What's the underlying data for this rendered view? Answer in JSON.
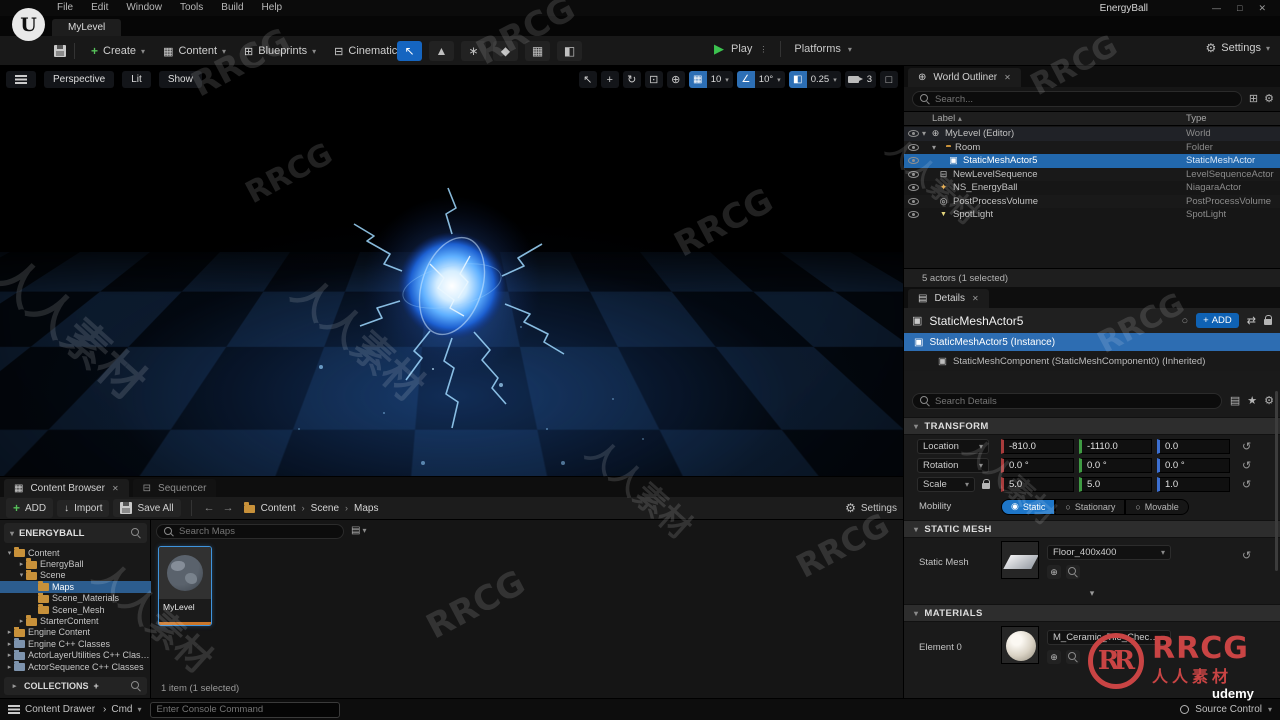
{
  "icons": {
    "caret_down": "▾",
    "caret_right": "▸",
    "caret_up": "▴",
    "chevron": "›",
    "gear": "⚙",
    "star": "★",
    "plus": "+",
    "play": "▶",
    "close": "✕",
    "minimize": "—",
    "maximize": "□",
    "dots": "⋮",
    "select": "↖",
    "move": "+",
    "rotate": "↻",
    "scale_tool": "⊡",
    "globe": "⊕",
    "grid": "▦",
    "angle": "∠",
    "scale_snap": "◧",
    "mesh": "▣",
    "sequence": "⊟",
    "particle": "✦",
    "postprocess": "◎",
    "spotlight": "▼",
    "back": "←",
    "forward": "→",
    "import_arrow": "↓",
    "swap": "⇄",
    "circle": "○",
    "undo": "↺",
    "radio_on": "◉",
    "radio_off": "○",
    "rows": "▤",
    "blueprint": "⊞",
    "cinematic": "⊟",
    "content": "▦"
  },
  "titlebar": {
    "logo": "U",
    "menus": [
      "File",
      "Edit",
      "Window",
      "Tools",
      "Build",
      "Help"
    ],
    "project": "EnergyBall"
  },
  "tabs": {
    "level_tab": "MyLevel"
  },
  "toolbar": {
    "create": "Create",
    "content": "Content",
    "blueprints": "Blueprints",
    "cinematics": "Cinematics",
    "play": "Play",
    "platforms": "Platforms",
    "settings": "Settings"
  },
  "viewport": {
    "perspective": "Perspective",
    "lit": "Lit",
    "show": "Show",
    "grid_value": "10",
    "angle_value": "10°",
    "scale_value": "0.25",
    "camera_value": "3"
  },
  "outliner": {
    "tab": "World Outliner",
    "search_placeholder": "Search...",
    "col_label": "Label",
    "col_type": "Type",
    "rows": [
      {
        "label": "MyLevel (Editor)",
        "type": "World"
      },
      {
        "label": "Room",
        "type": "Folder"
      },
      {
        "label": "StaticMeshActor5",
        "type": "StaticMeshActor"
      },
      {
        "label": "NewLevelSequence",
        "type": "LevelSequenceActor"
      },
      {
        "label": "NS_EnergyBall",
        "type": "NiagaraActor"
      },
      {
        "label": "PostProcessVolume",
        "type": "PostProcessVolume"
      },
      {
        "label": "SpotLight",
        "type": "SpotLight"
      }
    ],
    "status": "5 actors (1 selected)"
  },
  "details": {
    "tab": "Details",
    "actor_name": "StaticMeshActor5",
    "add_label": "ADD",
    "instance_label": "StaticMeshActor5 (Instance)",
    "component_label": "StaticMeshComponent (StaticMeshComponent0) (Inherited)",
    "search_placeholder": "Search Details",
    "sections": {
      "transform": "TRANSFORM",
      "static_mesh": "STATIC MESH",
      "materials": "MATERIALS"
    },
    "location": {
      "label": "Location",
      "x": "-810.0",
      "y": "-1110.0",
      "z": "0.0"
    },
    "rotation": {
      "label": "Rotation",
      "x": "0.0 °",
      "y": "0.0 °",
      "z": "0.0 °"
    },
    "scale": {
      "label": "Scale",
      "x": "5.0",
      "y": "5.0",
      "z": "1.0"
    },
    "mobility": {
      "label": "Mobility",
      "static": "Static",
      "stationary": "Stationary",
      "movable": "Movable"
    },
    "static_mesh_label": "Static Mesh",
    "static_mesh_value": "Floor_400x400",
    "element_label": "Element 0",
    "material_value": "M_Ceramic_Tile_Checker"
  },
  "content_browser": {
    "tab_browser": "Content Browser",
    "tab_sequencer": "Sequencer",
    "add": "ADD",
    "import": "Import",
    "save_all": "Save All",
    "crumb_root": "Content",
    "crumb_scene": "Scene",
    "crumb_maps": "Maps",
    "settings": "Settings",
    "search_placeholder": "Search Maps",
    "sources_title": "ENERGYBALL",
    "tree": [
      {
        "label": "Content"
      },
      {
        "label": "EnergyBall"
      },
      {
        "label": "Scene"
      },
      {
        "label": "Maps"
      },
      {
        "label": "Scene_Materials"
      },
      {
        "label": "Scene_Mesh"
      },
      {
        "label": "StarterContent"
      },
      {
        "label": "Engine Content"
      },
      {
        "label": "Engine C++ Classes"
      },
      {
        "label": "ActorLayerUtilities C++ Classes"
      },
      {
        "label": "ActorSequence C++ Classes"
      }
    ],
    "collections": "COLLECTIONS",
    "asset_name": "MyLevel",
    "status": "1 item (1 selected)"
  },
  "statusbar": {
    "content_drawer": "Content Drawer",
    "cmd": "Cmd",
    "console_placeholder": "Enter Console Command",
    "source_control": "Source Control"
  },
  "watermarks": {
    "brand": "RRCG",
    "brand_cn": "人人素材",
    "udemy": "udemy",
    "logo_text": "RRCG",
    "logo_sub": "人人素材",
    "logo_emblem": "RR"
  }
}
